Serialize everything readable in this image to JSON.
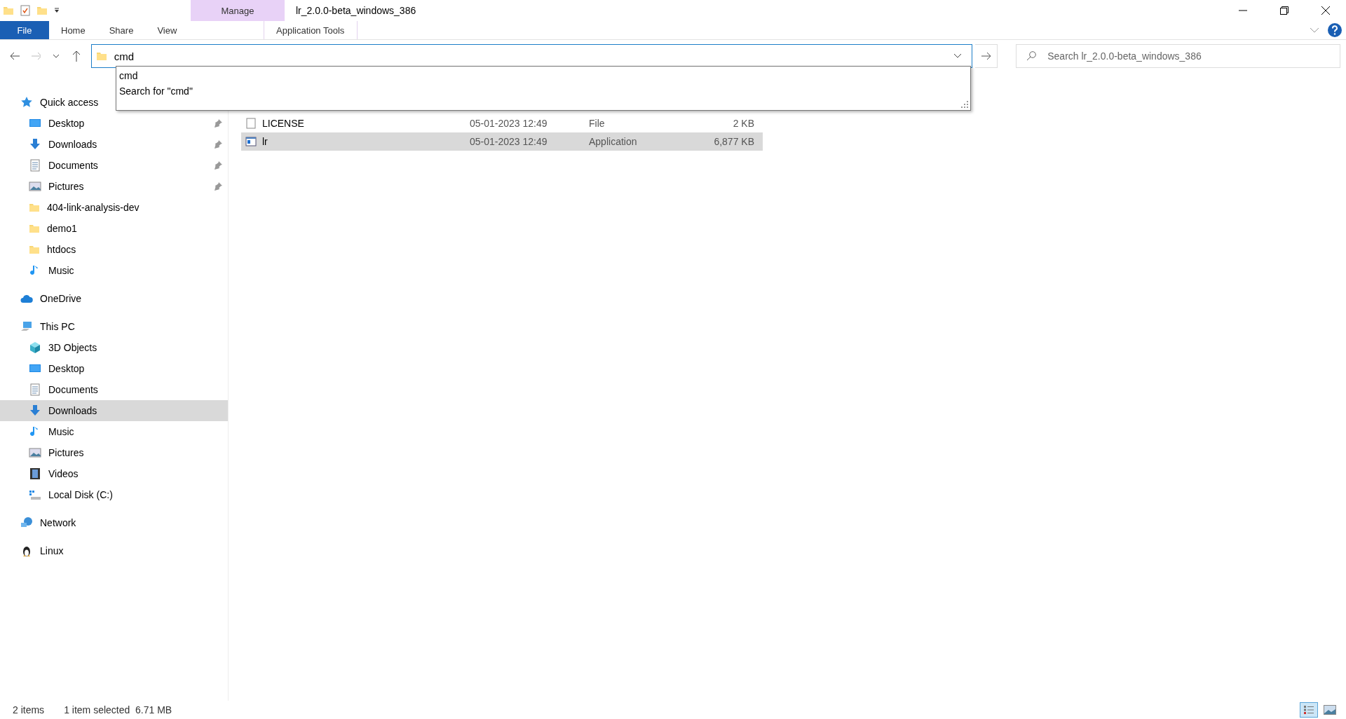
{
  "quick_access_toolbar": {
    "title": "lr_2.0.0-beta_windows_386"
  },
  "ribbon": {
    "context_group": "Manage",
    "tabs": [
      {
        "label": "File",
        "kind": "file",
        "selected": false
      },
      {
        "label": "Home",
        "kind": "tab",
        "selected": false
      },
      {
        "label": "Share",
        "kind": "tab",
        "selected": false
      },
      {
        "label": "View",
        "kind": "tab",
        "selected": false
      },
      {
        "label": "Application Tools",
        "kind": "context",
        "selected": false
      }
    ]
  },
  "address_bar": {
    "value": "cmd",
    "suggestions": [
      "cmd",
      "Search for \"cmd\""
    ]
  },
  "search": {
    "placeholder": "Search lr_2.0.0-beta_windows_386"
  },
  "sidebar": {
    "items": [
      {
        "label": "Quick access",
        "kind": "star",
        "selected": false,
        "children": [
          {
            "label": "Desktop",
            "kind": "desktop",
            "pinned": true,
            "selected": false
          },
          {
            "label": "Downloads",
            "kind": "download",
            "pinned": true,
            "selected": false
          },
          {
            "label": "Documents",
            "kind": "document",
            "pinned": true,
            "selected": false
          },
          {
            "label": "Pictures",
            "kind": "pictures",
            "pinned": true,
            "selected": false
          },
          {
            "label": "404-link-analysis-dev",
            "kind": "folder",
            "pinned": false,
            "selected": false
          },
          {
            "label": "demo1",
            "kind": "folder",
            "pinned": false,
            "selected": false
          },
          {
            "label": "htdocs",
            "kind": "folder",
            "pinned": false,
            "selected": false
          },
          {
            "label": "Music",
            "kind": "music",
            "pinned": false,
            "selected": false
          }
        ]
      },
      {
        "label": "OneDrive",
        "kind": "cloud",
        "selected": false
      },
      {
        "label": "This PC",
        "kind": "pc",
        "selected": false,
        "children": [
          {
            "label": "3D Objects",
            "kind": "cube",
            "pinned": false,
            "selected": false
          },
          {
            "label": "Desktop",
            "kind": "desktop",
            "pinned": false,
            "selected": false
          },
          {
            "label": "Documents",
            "kind": "document",
            "pinned": false,
            "selected": false
          },
          {
            "label": "Downloads",
            "kind": "download",
            "pinned": false,
            "selected": true
          },
          {
            "label": "Music",
            "kind": "music",
            "pinned": false,
            "selected": false
          },
          {
            "label": "Pictures",
            "kind": "pictures",
            "pinned": false,
            "selected": false
          },
          {
            "label": "Videos",
            "kind": "video",
            "pinned": false,
            "selected": false
          },
          {
            "label": "Local Disk (C:)",
            "kind": "disk",
            "pinned": false,
            "selected": false
          }
        ]
      },
      {
        "label": "Network",
        "kind": "network",
        "selected": false
      },
      {
        "label": "Linux",
        "kind": "penguin",
        "selected": false
      }
    ]
  },
  "files": [
    {
      "name": "LICENSE",
      "kind": "file",
      "date": "05-01-2023 12:49",
      "type": "File",
      "size": "2 KB",
      "selected": false
    },
    {
      "name": "lr",
      "kind": "app",
      "date": "05-01-2023 12:49",
      "type": "Application",
      "size": "6,877 KB",
      "selected": true
    }
  ],
  "status_bar": {
    "count": "2 items",
    "selection": "1 item selected  6.71 MB"
  }
}
